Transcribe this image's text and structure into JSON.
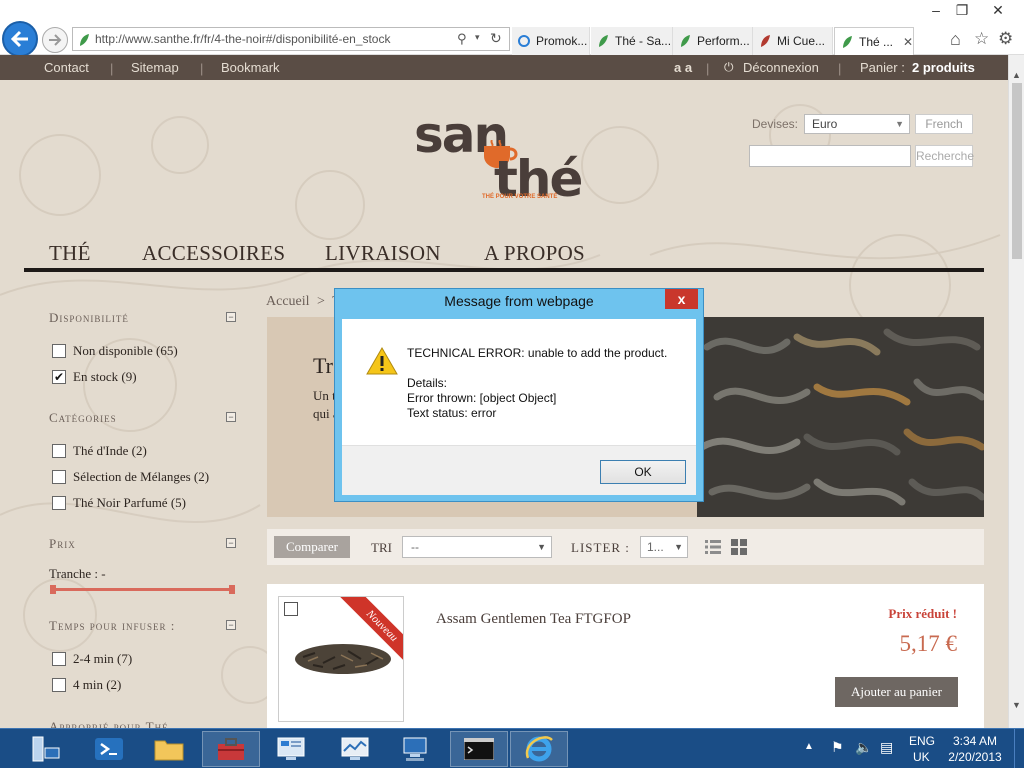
{
  "browser": {
    "address": "http://www.santhe.fr/fr/4-the-noir#/disponibilité-en_stock",
    "tabs": [
      {
        "label": "Promok...",
        "icon": "ie-page-icon"
      },
      {
        "label": "Thé - Sa...",
        "icon": "leaf-icon"
      },
      {
        "label": "Perform...",
        "icon": "leaf-icon"
      },
      {
        "label": "Mi Cue...",
        "icon": "leaf-icon"
      },
      {
        "label": "Thé ...",
        "icon": "leaf-icon",
        "active": true
      }
    ]
  },
  "topbar": {
    "contact": "Contact",
    "sitemap": "Sitemap",
    "bookmark": "Bookmark",
    "font_sizes": "a a",
    "logout": "Déconnexion",
    "cart_label": "Panier :",
    "cart_value": "2 produits"
  },
  "logo": {
    "line1": "san",
    "line2": "thé",
    "tagline": "THÉ POUR VOTRE SANTÉ"
  },
  "header": {
    "currency_label": "Devises:",
    "currency_value": "Euro",
    "language": "French",
    "search_button": "Recherche"
  },
  "menu": [
    "THÉ",
    "ACCESSOIRES",
    "LIVRAISON",
    "A PROPOS"
  ],
  "breadcrumb": {
    "home": "Accueil",
    "sep": ">",
    "current": "T"
  },
  "category": {
    "title": "Tr",
    "desc1": "Un t",
    "desc2": "qui a"
  },
  "facets": {
    "availability": {
      "title": "Disponibilité",
      "items": [
        {
          "label": "Non disponible (65)",
          "checked": false
        },
        {
          "label": "En stock (9)",
          "checked": true
        }
      ]
    },
    "categories": {
      "title": "Catégories",
      "items": [
        {
          "label": "Thé d'Inde (2)",
          "checked": false
        },
        {
          "label": "Sélection de Mélanges (2)",
          "checked": false
        },
        {
          "label": "Thé Noir Parfumé (5)",
          "checked": false
        }
      ]
    },
    "price": {
      "title": "Prix",
      "range_label": "Tranche : -"
    },
    "steep": {
      "title": "Temps pour infuser :",
      "items": [
        {
          "label": "2-4 min (7)",
          "checked": false
        },
        {
          "label": "4 min (2)",
          "checked": false
        }
      ]
    },
    "cutoff_title": "Approprié pour Thé"
  },
  "toolbar": {
    "compare": "Comparer",
    "sort_label": "TRI",
    "sort_value": "--",
    "list_label": "LISTER :",
    "list_value": "1..."
  },
  "product": {
    "name": "Assam Gentlemen Tea FTGFOP",
    "badge": "Nouveau",
    "price_label": "Prix réduit !",
    "price": "5,17 €",
    "add_to_cart": "Ajouter au panier"
  },
  "dialog": {
    "title": "Message from webpage",
    "close": "x",
    "line1": "TECHNICAL ERROR: unable to add the product.",
    "line2": "Details:",
    "line3": "Error thrown: [object Object]",
    "line4": "Text status: error",
    "ok": "OK"
  },
  "taskbar": {
    "lang1": "ENG",
    "lang2": "UK",
    "time": "3:34 AM",
    "date": "2/20/2013"
  },
  "colors": {
    "topbar": "#5a4d45",
    "price_red": "#c9443a",
    "price_orange": "#c86a50",
    "dialog_frame": "#6ec3ee",
    "taskbar": "#1a4d86"
  }
}
